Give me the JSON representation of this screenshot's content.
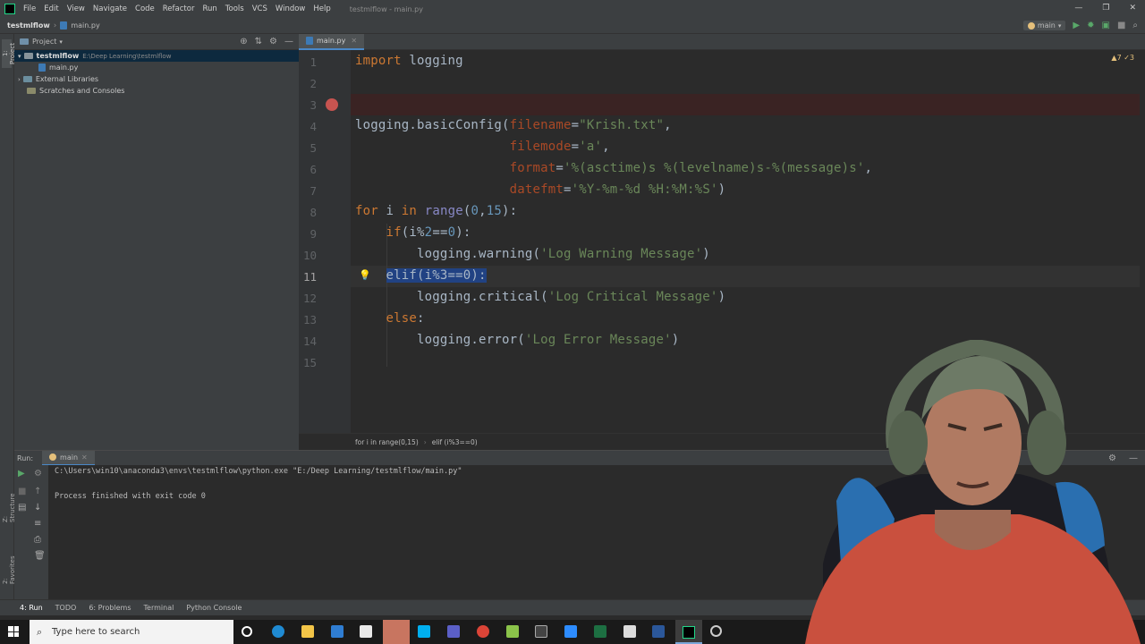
{
  "window": {
    "title": "testmlflow - main.py"
  },
  "menu": [
    "File",
    "Edit",
    "View",
    "Navigate",
    "Code",
    "Refactor",
    "Run",
    "Tools",
    "VCS",
    "Window",
    "Help"
  ],
  "nav": {
    "project": "testmlflow",
    "file": "main.py",
    "run_config": "main"
  },
  "project_panel": {
    "title": "Project",
    "root": {
      "name": "testmlflow",
      "path": "E:\\Deep Learning\\testmlflow"
    },
    "items": [
      {
        "label": "main.py"
      },
      {
        "label": "External Libraries"
      },
      {
        "label": "Scratches and Consoles"
      }
    ]
  },
  "editor": {
    "tab": "main.py",
    "inspections": "▲7 ✓3",
    "line_numbers": [
      "1",
      "2",
      "3",
      "4",
      "5",
      "6",
      "7",
      "8",
      "9",
      "10",
      "11",
      "12",
      "13",
      "14",
      "15"
    ],
    "lines": [
      [
        {
          "t": "import",
          "c": "kw"
        },
        {
          "t": " logging"
        }
      ],
      [],
      [],
      [
        {
          "t": "logging.basicConfig("
        },
        {
          "t": "filename",
          "c": "param"
        },
        {
          "t": "="
        },
        {
          "t": "\"Krish.txt\"",
          "c": "str"
        },
        {
          "t": ","
        }
      ],
      [
        {
          "t": "                    "
        },
        {
          "t": "filemode",
          "c": "param"
        },
        {
          "t": "="
        },
        {
          "t": "'a'",
          "c": "str"
        },
        {
          "t": ","
        }
      ],
      [
        {
          "t": "                    "
        },
        {
          "t": "format",
          "c": "param"
        },
        {
          "t": "="
        },
        {
          "t": "'%(asctime)s %(levelname)s-%(message)s'",
          "c": "str"
        },
        {
          "t": ","
        }
      ],
      [
        {
          "t": "                    "
        },
        {
          "t": "datefmt",
          "c": "param"
        },
        {
          "t": "="
        },
        {
          "t": "'%Y-%m-%d %H:%M:%S'",
          "c": "str"
        },
        {
          "t": ")"
        }
      ],
      [
        {
          "t": "for",
          "c": "kw"
        },
        {
          "t": " i "
        },
        {
          "t": "in",
          "c": "kw"
        },
        {
          "t": " "
        },
        {
          "t": "range",
          "c": "bi"
        },
        {
          "t": "("
        },
        {
          "t": "0",
          "c": "num"
        },
        {
          "t": ","
        },
        {
          "t": "15",
          "c": "num"
        },
        {
          "t": "):"
        }
      ],
      [
        {
          "t": "    "
        },
        {
          "t": "if",
          "c": "kw"
        },
        {
          "t": "(i%"
        },
        {
          "t": "2",
          "c": "num"
        },
        {
          "t": "=="
        },
        {
          "t": "0",
          "c": "num"
        },
        {
          "t": "):"
        }
      ],
      [
        {
          "t": "        logging.warning("
        },
        {
          "t": "'Log Warning Message'",
          "c": "str"
        },
        {
          "t": ")"
        }
      ],
      [
        {
          "t": "    "
        },
        {
          "t": "elif(i%3==0):",
          "c": "selx"
        }
      ],
      [
        {
          "t": "        logging.critical("
        },
        {
          "t": "'Log Critical Message'",
          "c": "str"
        },
        {
          "t": ")"
        }
      ],
      [
        {
          "t": "    "
        },
        {
          "t": "else",
          "c": "kw"
        },
        {
          "t": ":"
        }
      ],
      [
        {
          "t": "        logging.error("
        },
        {
          "t": "'Log Error Message'",
          "c": "str"
        },
        {
          "t": ")"
        }
      ],
      []
    ],
    "breadcrumbs": [
      "for i in range(0,15)",
      "elif (i%3==0)"
    ]
  },
  "run_panel": {
    "label": "Run:",
    "tab": "main",
    "output": [
      "C:\\Users\\win10\\anaconda3\\envs\\testmlflow\\python.exe \"E:/Deep Learning/testmlflow/main.py\"",
      "",
      "Process finished with exit code 0"
    ]
  },
  "bottom_tabs": [
    "4: Run",
    "TODO",
    "6: Problems",
    "Terminal",
    "Python Console"
  ],
  "taskbar": {
    "search_placeholder": "Type here to search"
  },
  "side_labels": {
    "project": "1: Project",
    "structure": "Z: Structure",
    "favorites": "2: Favorites"
  }
}
